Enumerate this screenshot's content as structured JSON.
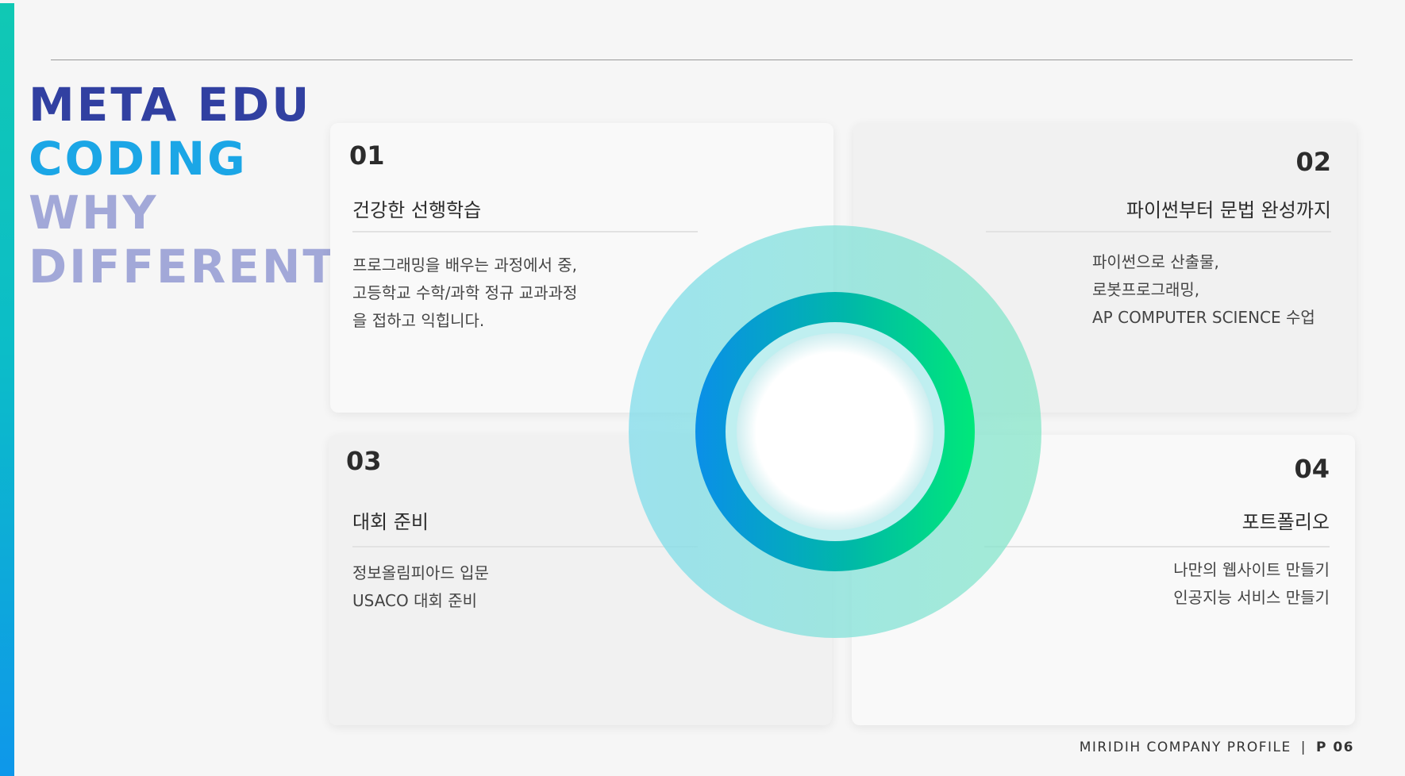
{
  "headline": {
    "line1": "META EDU",
    "line2": "CODING",
    "line3": "WHY",
    "line4": "DIFFERENT?"
  },
  "cards": [
    {
      "number": "01",
      "title": "건강한 선행학습",
      "lines": [
        "프로그래밍을 배우는 과정에서 중,",
        "고등학교 수학/과학 정규 교과과정",
        "을 접하고 익힙니다."
      ]
    },
    {
      "number": "02",
      "title": "파이썬부터 문법 완성까지",
      "lines": [
        "파이썬으로 산출물,",
        "로봇프로그래밍,",
        "AP COMPUTER SCIENCE 수업"
      ]
    },
    {
      "number": "03",
      "title": "대회 준비",
      "lines": [
        "정보올림피아드 입문",
        "USACO 대회  준비"
      ]
    },
    {
      "number": "04",
      "title": "포트폴리오",
      "lines": [
        "나만의 웹사이트 만들기",
        "인공지능 서비스 만들기"
      ]
    }
  ],
  "footer": {
    "company": "MIRIDIH COMPANY PROFILE",
    "separator": "|",
    "page": "P 06"
  },
  "colors": {
    "accent_teal": "#10c8b4",
    "accent_blue": "#0e97ea",
    "headline_navy": "#3140a1",
    "headline_blue": "#1ba6e6",
    "headline_lavender": "#a2a8d8",
    "ring_gradient_start": "#0a8fe8",
    "ring_gradient_end": "#00e87a"
  }
}
